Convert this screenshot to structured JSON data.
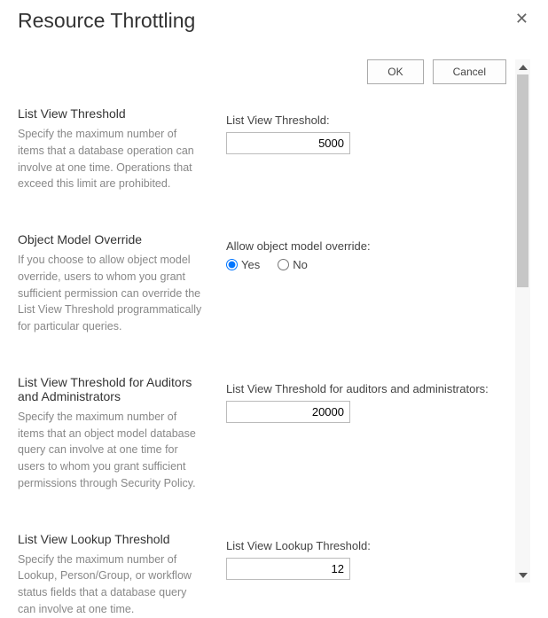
{
  "dialog": {
    "title": "Resource Throttling"
  },
  "buttons": {
    "ok": "OK",
    "cancel": "Cancel"
  },
  "sections": {
    "lvt": {
      "title": "List View Threshold",
      "desc": "Specify the maximum number of items that a database operation can involve at one time. Operations that exceed this limit are prohibited.",
      "field_label": "List View Threshold:",
      "value": "5000"
    },
    "omo": {
      "title": "Object Model Override",
      "desc": "If you choose to allow object model override, users to whom you grant sufficient permission can override the List View Threshold programmatically for particular queries.",
      "field_label": "Allow object model override:",
      "yes_label": "Yes",
      "no_label": "No"
    },
    "lvta": {
      "title": "List View Threshold for Auditors and Administrators",
      "desc": "Specify the maximum number of items that an object model database query can involve at one time for users to whom you grant sufficient permissions through Security Policy.",
      "field_label": "List View Threshold for auditors and administrators:",
      "value": "20000"
    },
    "lvlt": {
      "title": "List View Lookup Threshold",
      "desc": "Specify the maximum number of Lookup, Person/Group, or workflow status fields that a database query can involve at one time.",
      "field_label": "List View Lookup Threshold:",
      "value": "12"
    }
  }
}
